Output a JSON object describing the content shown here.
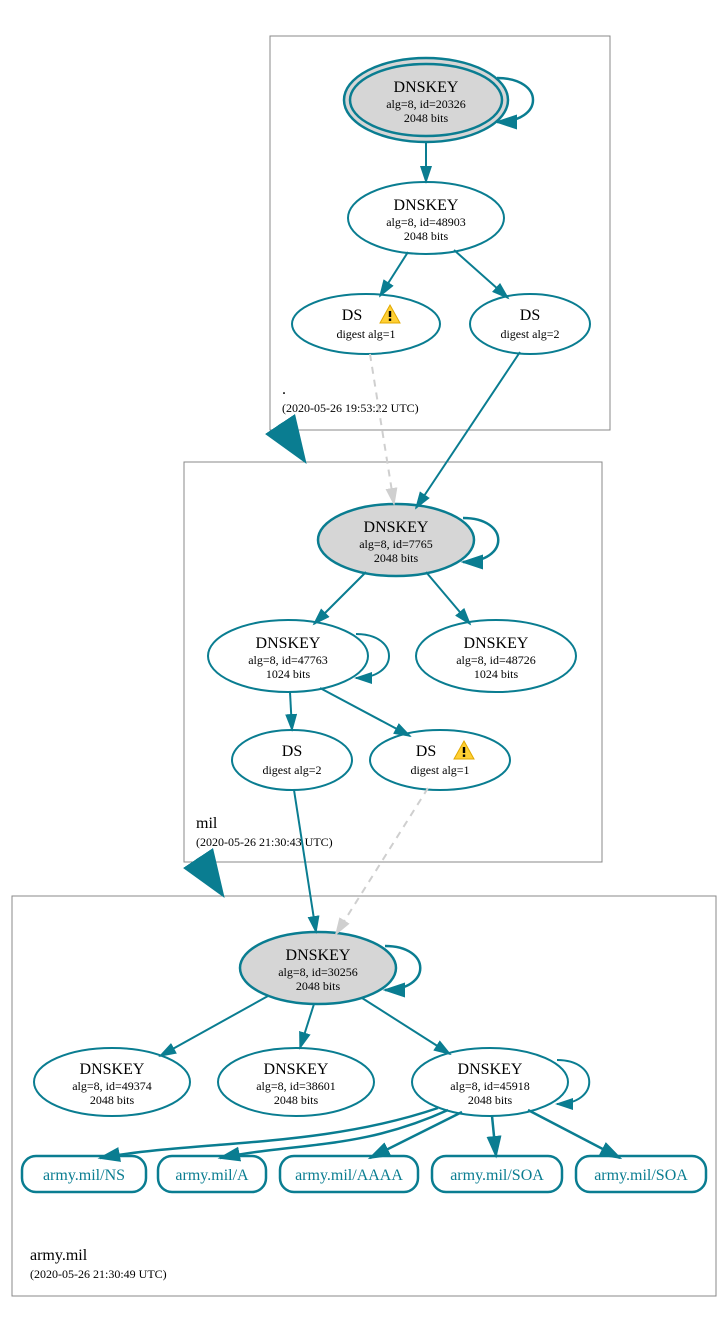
{
  "zones": {
    "root": {
      "name": ".",
      "timestamp": "(2020-05-26 19:53:22 UTC)",
      "nodes": {
        "ksk": {
          "title": "DNSKEY",
          "line1": "alg=8, id=20326",
          "line2": "2048 bits"
        },
        "zsk": {
          "title": "DNSKEY",
          "line1": "alg=8, id=48903",
          "line2": "2048 bits"
        },
        "ds1": {
          "title": "DS",
          "line1": "digest alg=1"
        },
        "ds2": {
          "title": "DS",
          "line1": "digest alg=2"
        }
      }
    },
    "mil": {
      "name": "mil",
      "timestamp": "(2020-05-26 21:30:43 UTC)",
      "nodes": {
        "ksk": {
          "title": "DNSKEY",
          "line1": "alg=8, id=7765",
          "line2": "2048 bits"
        },
        "zsk1": {
          "title": "DNSKEY",
          "line1": "alg=8, id=47763",
          "line2": "1024 bits"
        },
        "zsk2": {
          "title": "DNSKEY",
          "line1": "alg=8, id=48726",
          "line2": "1024 bits"
        },
        "ds2": {
          "title": "DS",
          "line1": "digest alg=2"
        },
        "ds1": {
          "title": "DS",
          "line1": "digest alg=1"
        }
      }
    },
    "army": {
      "name": "army.mil",
      "timestamp": "(2020-05-26 21:30:49 UTC)",
      "nodes": {
        "ksk": {
          "title": "DNSKEY",
          "line1": "alg=8, id=30256",
          "line2": "2048 bits"
        },
        "zsk1": {
          "title": "DNSKEY",
          "line1": "alg=8, id=49374",
          "line2": "2048 bits"
        },
        "zsk2": {
          "title": "DNSKEY",
          "line1": "alg=8, id=38601",
          "line2": "2048 bits"
        },
        "zsk3": {
          "title": "DNSKEY",
          "line1": "alg=8, id=45918",
          "line2": "2048 bits"
        }
      },
      "rr": {
        "ns": "army.mil/NS",
        "a": "army.mil/A",
        "aaaa": "army.mil/AAAA",
        "soa1": "army.mil/SOA",
        "soa2": "army.mil/SOA"
      }
    }
  }
}
